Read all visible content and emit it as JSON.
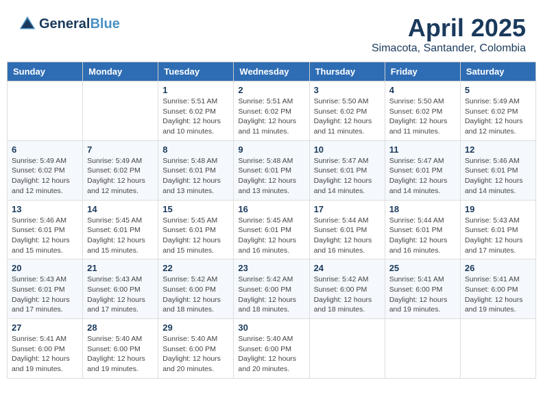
{
  "header": {
    "logo_line1": "General",
    "logo_line2": "Blue",
    "month_title": "April 2025",
    "subtitle": "Simacota, Santander, Colombia"
  },
  "days_of_week": [
    "Sunday",
    "Monday",
    "Tuesday",
    "Wednesday",
    "Thursday",
    "Friday",
    "Saturday"
  ],
  "weeks": [
    [
      {
        "day": "",
        "detail": ""
      },
      {
        "day": "",
        "detail": ""
      },
      {
        "day": "1",
        "detail": "Sunrise: 5:51 AM\nSunset: 6:02 PM\nDaylight: 12 hours and 10 minutes."
      },
      {
        "day": "2",
        "detail": "Sunrise: 5:51 AM\nSunset: 6:02 PM\nDaylight: 12 hours and 11 minutes."
      },
      {
        "day": "3",
        "detail": "Sunrise: 5:50 AM\nSunset: 6:02 PM\nDaylight: 12 hours and 11 minutes."
      },
      {
        "day": "4",
        "detail": "Sunrise: 5:50 AM\nSunset: 6:02 PM\nDaylight: 12 hours and 11 minutes."
      },
      {
        "day": "5",
        "detail": "Sunrise: 5:49 AM\nSunset: 6:02 PM\nDaylight: 12 hours and 12 minutes."
      }
    ],
    [
      {
        "day": "6",
        "detail": "Sunrise: 5:49 AM\nSunset: 6:02 PM\nDaylight: 12 hours and 12 minutes."
      },
      {
        "day": "7",
        "detail": "Sunrise: 5:49 AM\nSunset: 6:02 PM\nDaylight: 12 hours and 12 minutes."
      },
      {
        "day": "8",
        "detail": "Sunrise: 5:48 AM\nSunset: 6:01 PM\nDaylight: 12 hours and 13 minutes."
      },
      {
        "day": "9",
        "detail": "Sunrise: 5:48 AM\nSunset: 6:01 PM\nDaylight: 12 hours and 13 minutes."
      },
      {
        "day": "10",
        "detail": "Sunrise: 5:47 AM\nSunset: 6:01 PM\nDaylight: 12 hours and 14 minutes."
      },
      {
        "day": "11",
        "detail": "Sunrise: 5:47 AM\nSunset: 6:01 PM\nDaylight: 12 hours and 14 minutes."
      },
      {
        "day": "12",
        "detail": "Sunrise: 5:46 AM\nSunset: 6:01 PM\nDaylight: 12 hours and 14 minutes."
      }
    ],
    [
      {
        "day": "13",
        "detail": "Sunrise: 5:46 AM\nSunset: 6:01 PM\nDaylight: 12 hours and 15 minutes."
      },
      {
        "day": "14",
        "detail": "Sunrise: 5:45 AM\nSunset: 6:01 PM\nDaylight: 12 hours and 15 minutes."
      },
      {
        "day": "15",
        "detail": "Sunrise: 5:45 AM\nSunset: 6:01 PM\nDaylight: 12 hours and 15 minutes."
      },
      {
        "day": "16",
        "detail": "Sunrise: 5:45 AM\nSunset: 6:01 PM\nDaylight: 12 hours and 16 minutes."
      },
      {
        "day": "17",
        "detail": "Sunrise: 5:44 AM\nSunset: 6:01 PM\nDaylight: 12 hours and 16 minutes."
      },
      {
        "day": "18",
        "detail": "Sunrise: 5:44 AM\nSunset: 6:01 PM\nDaylight: 12 hours and 16 minutes."
      },
      {
        "day": "19",
        "detail": "Sunrise: 5:43 AM\nSunset: 6:01 PM\nDaylight: 12 hours and 17 minutes."
      }
    ],
    [
      {
        "day": "20",
        "detail": "Sunrise: 5:43 AM\nSunset: 6:01 PM\nDaylight: 12 hours and 17 minutes."
      },
      {
        "day": "21",
        "detail": "Sunrise: 5:43 AM\nSunset: 6:00 PM\nDaylight: 12 hours and 17 minutes."
      },
      {
        "day": "22",
        "detail": "Sunrise: 5:42 AM\nSunset: 6:00 PM\nDaylight: 12 hours and 18 minutes."
      },
      {
        "day": "23",
        "detail": "Sunrise: 5:42 AM\nSunset: 6:00 PM\nDaylight: 12 hours and 18 minutes."
      },
      {
        "day": "24",
        "detail": "Sunrise: 5:42 AM\nSunset: 6:00 PM\nDaylight: 12 hours and 18 minutes."
      },
      {
        "day": "25",
        "detail": "Sunrise: 5:41 AM\nSunset: 6:00 PM\nDaylight: 12 hours and 19 minutes."
      },
      {
        "day": "26",
        "detail": "Sunrise: 5:41 AM\nSunset: 6:00 PM\nDaylight: 12 hours and 19 minutes."
      }
    ],
    [
      {
        "day": "27",
        "detail": "Sunrise: 5:41 AM\nSunset: 6:00 PM\nDaylight: 12 hours and 19 minutes."
      },
      {
        "day": "28",
        "detail": "Sunrise: 5:40 AM\nSunset: 6:00 PM\nDaylight: 12 hours and 19 minutes."
      },
      {
        "day": "29",
        "detail": "Sunrise: 5:40 AM\nSunset: 6:00 PM\nDaylight: 12 hours and 20 minutes."
      },
      {
        "day": "30",
        "detail": "Sunrise: 5:40 AM\nSunset: 6:00 PM\nDaylight: 12 hours and 20 minutes."
      },
      {
        "day": "",
        "detail": ""
      },
      {
        "day": "",
        "detail": ""
      },
      {
        "day": "",
        "detail": ""
      }
    ]
  ]
}
